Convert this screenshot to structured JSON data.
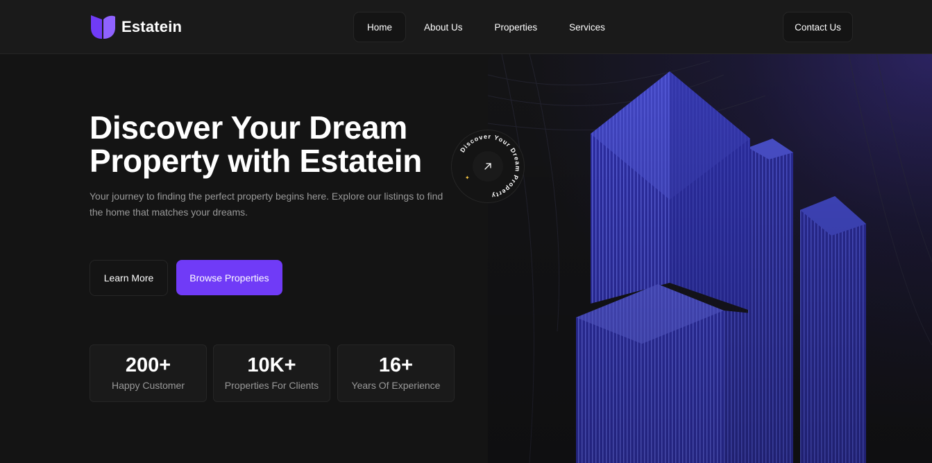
{
  "brand": {
    "name": "Estatein",
    "accent": "#703bf7"
  },
  "nav": {
    "items": [
      {
        "label": "Home",
        "active": true
      },
      {
        "label": "About Us",
        "active": false
      },
      {
        "label": "Properties",
        "active": false
      },
      {
        "label": "Services",
        "active": false
      }
    ],
    "contact_label": "Contact Us"
  },
  "hero": {
    "title_line1": "Discover Your Dream",
    "title_line2": "Property with Estatein",
    "subtitle": "Your journey to finding the perfect property begins here. Explore our listings to find the home that matches your dreams.",
    "learn_more_label": "Learn More",
    "browse_label": "Browse Properties",
    "badge_text": "Discover Your Dream Property",
    "badge_icon": "arrow-up-right-icon"
  },
  "stats": [
    {
      "value": "200+",
      "label": "Happy Customer"
    },
    {
      "value": "10K+",
      "label": "Properties For Clients"
    },
    {
      "value": "16+",
      "label": "Years Of Experience"
    }
  ]
}
